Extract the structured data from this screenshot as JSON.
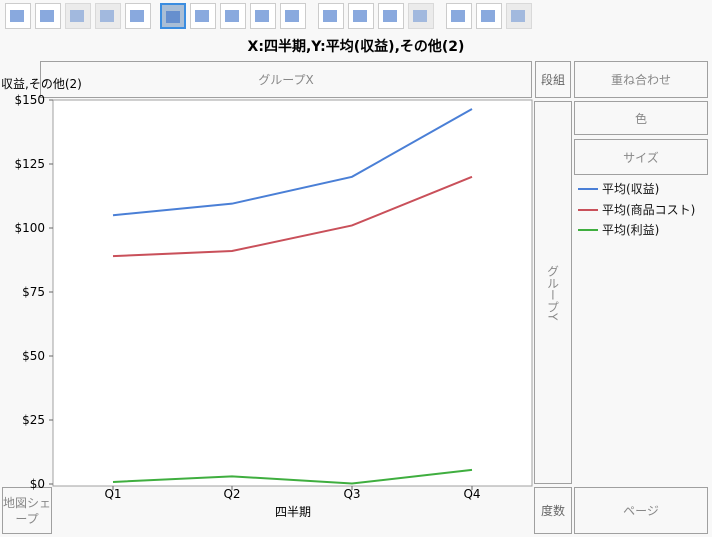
{
  "toolbar": {
    "icons": [
      "points-icon",
      "smoother-icon",
      "line-of-fit-icon",
      "ellipse-icon",
      "contour-icon",
      "line-icon",
      "bar-icon",
      "area-icon",
      "box-plot-icon",
      "histogram-icon",
      "heatmap-icon",
      "pie-icon",
      "treemap-icon",
      "mosaic-icon",
      "caption-box-icon",
      "formula-icon",
      "map-shapes-icon"
    ],
    "selected": "line-icon"
  },
  "title": "X:四半期,Y:平均(収益),その他(2)",
  "zones": {
    "group_x": "グループX",
    "wrap": "段組",
    "overlay": "重ね合わせ",
    "color": "色",
    "size": "サイズ",
    "group_y": "グループY",
    "map_shape": "地図シェープ",
    "freq": "度数",
    "page": "ページ"
  },
  "y_axis_label": "収益,その他(2)",
  "x_axis_label": "四半期",
  "legend": [
    {
      "label": "平均(収益)",
      "color": "#4a7fd6"
    },
    {
      "label": "平均(商品コスト)",
      "color": "#c9505a"
    },
    {
      "label": "平均(利益)",
      "color": "#3fae3f"
    }
  ],
  "chart_data": {
    "type": "line",
    "categories": [
      "Q1",
      "Q2",
      "Q3",
      "Q4"
    ],
    "series": [
      {
        "name": "平均(収益)",
        "values": [
          105,
          109.5,
          120,
          146.5
        ]
      },
      {
        "name": "平均(商品コスト)",
        "values": [
          89,
          91,
          101,
          120
        ]
      },
      {
        "name": "平均(利益)",
        "values": [
          0.8,
          3,
          0.2,
          5.5
        ]
      }
    ],
    "yticks": [
      "$0",
      "$25",
      "$50",
      "$75",
      "$100",
      "$125",
      "$150"
    ],
    "ylim": [
      0,
      150
    ],
    "xlabel": "四半期",
    "ylabel": "収益,その他(2)"
  }
}
